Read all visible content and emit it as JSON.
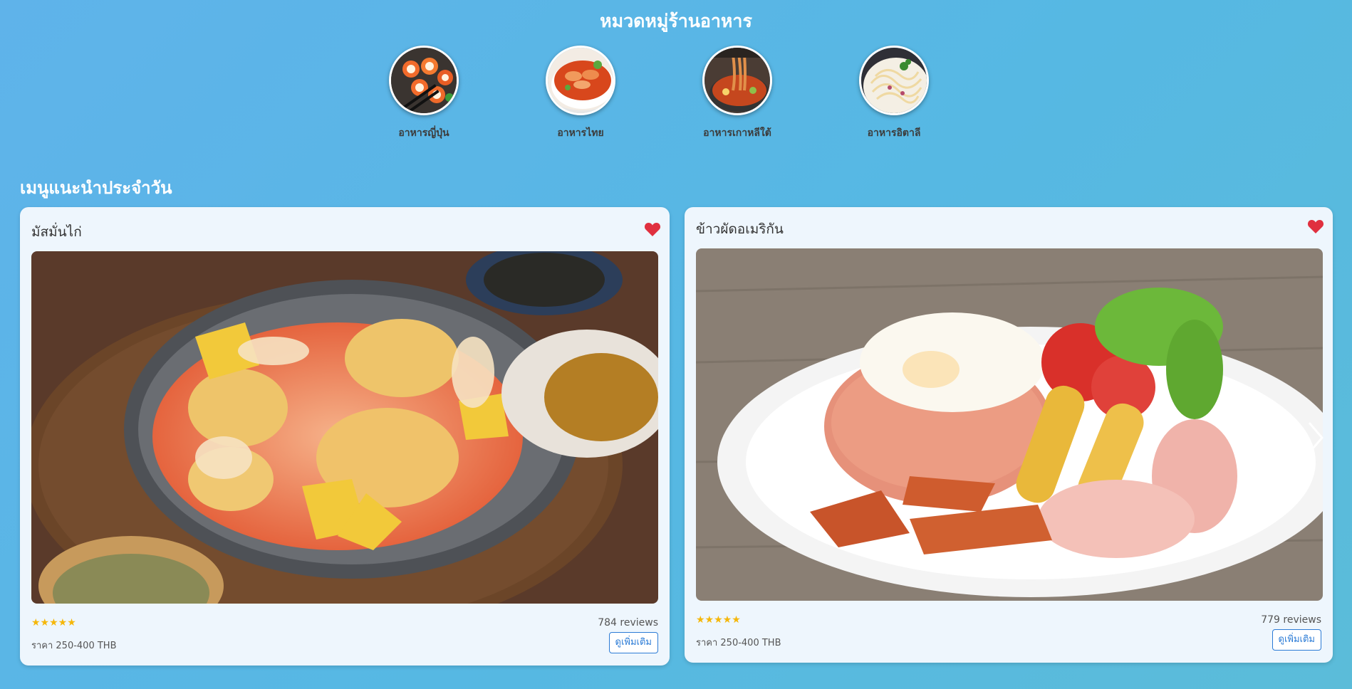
{
  "categories": {
    "title": "หมวดหมู่ร้านอาหาร",
    "items": [
      {
        "label": "อาหารญี่ปุ่น",
        "icon": "sushi-image"
      },
      {
        "label": "อาหารไทย",
        "icon": "thai-food-image"
      },
      {
        "label": "อาหารเกาหลีใต้",
        "icon": "korean-food-image"
      },
      {
        "label": "อาหารอิตาลี",
        "icon": "italian-food-image"
      }
    ]
  },
  "recommended": {
    "title": "เมนูแนะนำประจำวัน",
    "cards": [
      {
        "name": "มัสมั่นไก่",
        "stars": "★★★★★",
        "reviews": "784 reviews",
        "price": "ราคา 250-400 THB",
        "button": "ดูเพิ่มเติม"
      },
      {
        "name": "ข้าวผัดอเมริกัน",
        "stars": "★★★★★",
        "reviews": "779 reviews",
        "price": "ราคา 250-400 THB",
        "button": "ดูเพิ่มเติม"
      }
    ]
  },
  "colors": {
    "background": "#5fb3ea",
    "card": "#eef6fd",
    "heart": "#e0303f",
    "star": "#f5b70a",
    "button_accent": "#2b7bd6"
  }
}
